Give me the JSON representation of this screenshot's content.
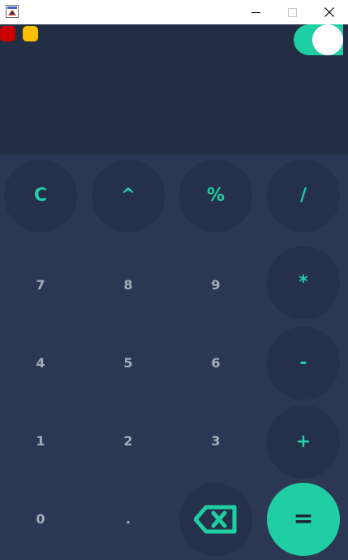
{
  "window": {
    "minimize_icon": "minimize-icon",
    "maximize_icon": "maximize-icon",
    "close_icon": "close-icon"
  },
  "colors": {
    "display_bg": "#232e45",
    "keypad_bg": "#2c3853",
    "key_bg": "#25304a",
    "accent": "#1fcfa3",
    "number_text": "#a7adb9",
    "red_dot": "#cc0000",
    "yellow_dot": "#f8c000"
  },
  "display": {
    "value": "",
    "theme_toggle": "on"
  },
  "keys": {
    "clear": "C",
    "power": "^",
    "percent": "%",
    "divide": "/",
    "seven": "7",
    "eight": "8",
    "nine": "9",
    "multiply": "*",
    "four": "4",
    "five": "5",
    "six": "6",
    "minus": "-",
    "one": "1",
    "two": "2",
    "three": "3",
    "plus": "+",
    "zero": "0",
    "decimal": ".",
    "backspace_icon": "backspace-icon",
    "equals": "="
  }
}
